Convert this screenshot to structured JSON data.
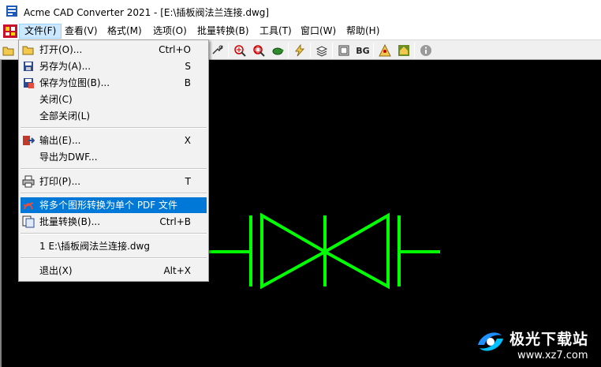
{
  "window": {
    "title": "Acme CAD Converter 2021 - [E:\\插板阀法兰连接.dwg]"
  },
  "menubar": {
    "items": [
      {
        "label": "文件(F)"
      },
      {
        "label": "查看(V)"
      },
      {
        "label": "格式(M)"
      },
      {
        "label": "选项(O)"
      },
      {
        "label": "批量转换(B)"
      },
      {
        "label": "工具(T)"
      },
      {
        "label": "窗口(W)"
      },
      {
        "label": "帮助(H)"
      }
    ]
  },
  "toolbar": {
    "bg_label": "BG"
  },
  "file_menu": {
    "items": [
      {
        "label": "打开(O)...",
        "shortcut": "Ctrl+O"
      },
      {
        "label": "另存为(A)...",
        "shortcut": "S"
      },
      {
        "label": "保存为位图(B)...",
        "shortcut": "B"
      },
      {
        "label": "关闭(C)",
        "shortcut": ""
      },
      {
        "label": "全部关闭(L)",
        "shortcut": ""
      },
      {
        "label": "输出(E)...",
        "shortcut": "X"
      },
      {
        "label": "导出为DWF...",
        "shortcut": ""
      },
      {
        "label": "打印(P)...",
        "shortcut": "T"
      },
      {
        "label": "将多个图形转换为单个 PDF 文件",
        "shortcut": ""
      },
      {
        "label": "批量转换(B)...",
        "shortcut": "Ctrl+B"
      },
      {
        "label": "1 E:\\插板阀法兰连接.dwg",
        "shortcut": ""
      },
      {
        "label": "退出(X)",
        "shortcut": "Alt+X"
      }
    ]
  },
  "watermark": {
    "text": "极光下载站",
    "url": "www.xz7.com"
  },
  "colors": {
    "canvas": "#000000",
    "drawing": "#00ff00",
    "highlight": "#0078d7"
  }
}
